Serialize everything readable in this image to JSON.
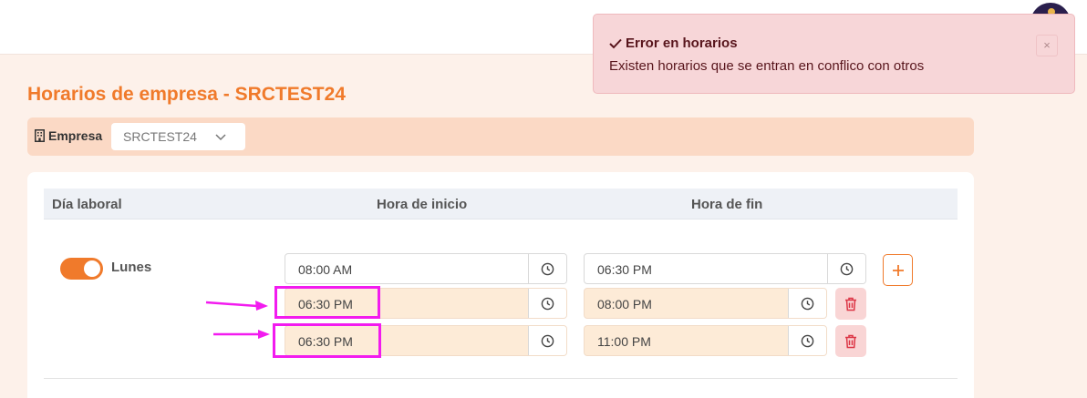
{
  "page": {
    "title": "Horarios de empresa - SRCTEST24"
  },
  "filter": {
    "label": "Empresa",
    "selected": "SRCTEST24",
    "icon": "building-icon"
  },
  "table": {
    "headers": [
      "Día laboral",
      "Hora de inicio",
      "Hora de fin"
    ],
    "days": [
      {
        "label": "Lunes",
        "enabled": true,
        "slots": [
          {
            "start": "08:00 AM",
            "end": "06:30 PM"
          },
          {
            "start": "06:30 PM",
            "end": "08:00 PM"
          },
          {
            "start": "06:30 PM",
            "end": "11:00 PM"
          }
        ]
      }
    ]
  },
  "toast": {
    "title": "Error en horarios",
    "message": "Existen horarios que se entran en conflico con otros",
    "close": "×"
  },
  "colors": {
    "accent": "#f07a2b",
    "error_bg": "#f7d6d8",
    "error_text": "#58151c",
    "annotation": "#f21bef"
  },
  "icons": [
    "clock-icon",
    "plus-icon",
    "trash-icon",
    "check-icon",
    "close-icon",
    "chevron-down-icon",
    "building-icon"
  ]
}
